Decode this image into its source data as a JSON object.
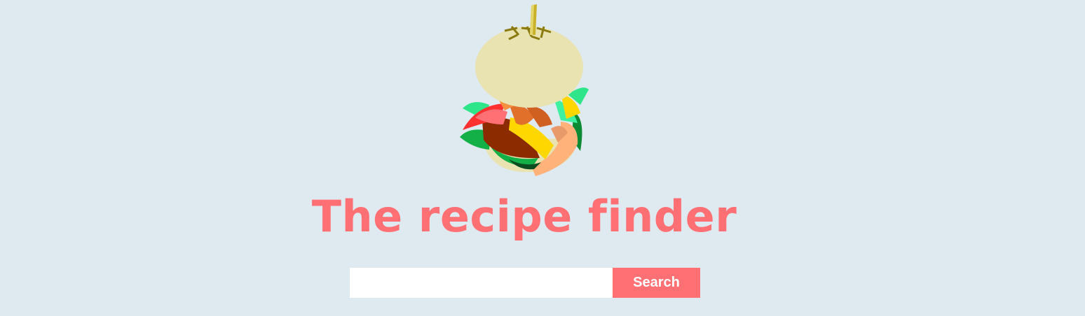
{
  "header": {
    "title": "The recipe finder",
    "logo_icon": "burger-icon"
  },
  "search": {
    "value": "",
    "placeholder": "",
    "button_label": "Search"
  },
  "colors": {
    "background": "#dfe9f0",
    "accent": "#ff7075",
    "input_background": "#ffffff",
    "button_text": "#ffffff"
  }
}
